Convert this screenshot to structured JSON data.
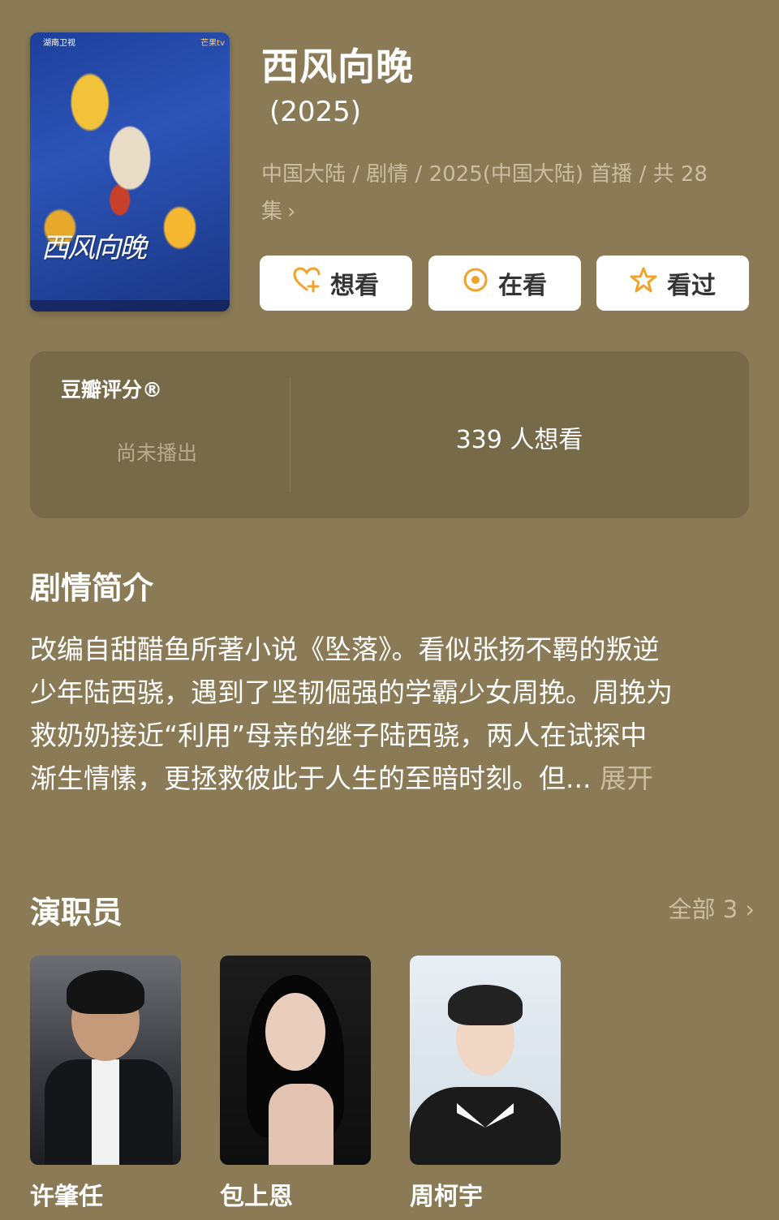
{
  "poster": {
    "badge_left": "湖南卫视",
    "badge_right": "芒果tv",
    "calligraphy": "西风向晚"
  },
  "header": {
    "title": "西风向晚",
    "year": "(2025)",
    "meta_line1": "中国大陆 / 剧情 / 2025(中国大陆) 首播 / 共 28",
    "meta_line2": "集",
    "meta_chevron": "›"
  },
  "actions": {
    "want_label": "想看",
    "want_icon": "heart-plus-icon",
    "watching_label": "在看",
    "watching_icon": "target-circle-icon",
    "watched_label": "看过",
    "watched_icon": "star-icon",
    "icon_color": "#f0a22a"
  },
  "rating": {
    "title": "豆瓣评分®",
    "status": "尚未播出",
    "want_count": "339 人想看"
  },
  "synopsis": {
    "title": "剧情简介",
    "line1": "改编自甜醋鱼所著小说《坠落》。看似张扬不羁的叛逆",
    "line2": "少年陆西骁，遇到了坚韧倔强的学霸少女周挽。周挽为",
    "line3": "救奶奶接近“利用”母亲的继子陆西骁，两人在试探中",
    "line4_text": "渐生情愫，更拯救彼此于人生的至暗时刻。但... ",
    "expand": "展开"
  },
  "cast": {
    "title": "演职员",
    "all_label": "全部 3",
    "all_chevron": "›",
    "members": [
      {
        "name": "许肇任"
      },
      {
        "name": "包上恩"
      },
      {
        "name": "周柯宇"
      }
    ]
  },
  "colors": {
    "background": "#8a7b56",
    "card": "#776a48",
    "muted_text": "#c9bea1",
    "accent": "#f0a22a"
  }
}
